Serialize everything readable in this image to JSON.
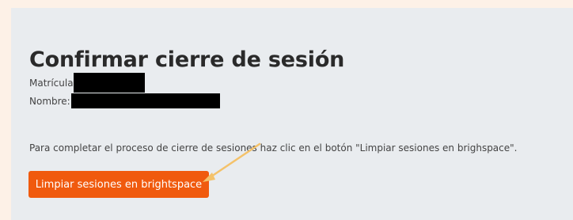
{
  "page": {
    "title": "Confirmar cierre de sesión",
    "fields": {
      "matricula_label": "Matrícula:",
      "nombre_label": "Nombre:"
    },
    "instructions": "Para completar el proceso de cierre de sesiones haz clic en el botón \"Limpiar sesiones en brighspace\".",
    "button_label": "Limpiar sesiones en brightspace"
  },
  "colors": {
    "page_background": "#fdf1e7",
    "panel_background": "#e9ecef",
    "button": "#f05a0e",
    "arrow": "#f4c26a"
  },
  "icons": {
    "annotation": "arrow-annotation-icon"
  }
}
